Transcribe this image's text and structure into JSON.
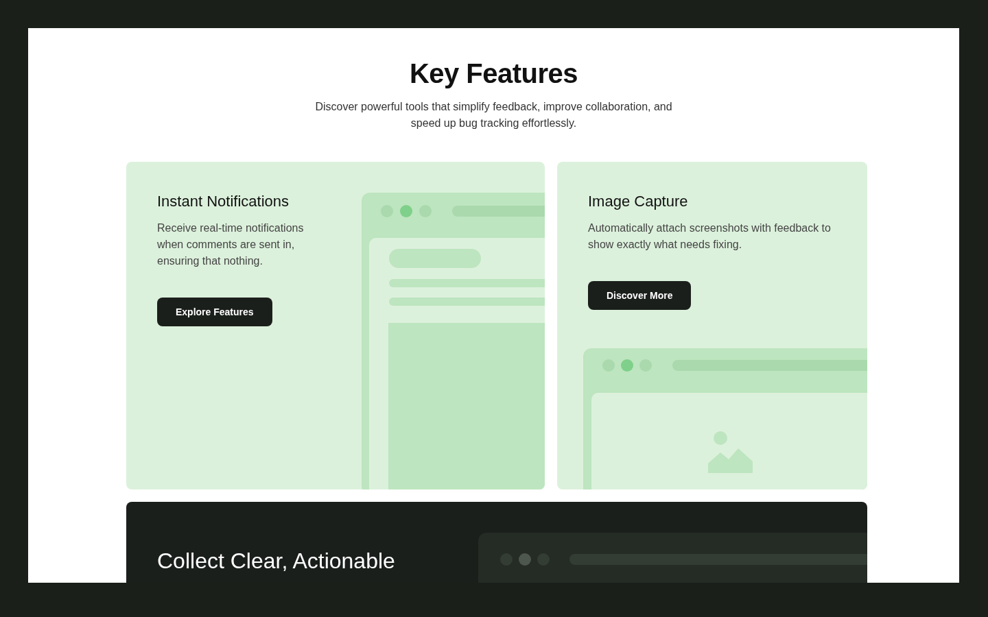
{
  "section": {
    "title": "Key Features",
    "subtitle": "Discover powerful tools that simplify feedback, improve collaboration, and speed up bug tracking effortlessly."
  },
  "cards": [
    {
      "kind": "page",
      "title": "Instant Notifications",
      "description": "Receive real-time notifications when comments are sent in, ensuring that nothing.",
      "button": "Explore Features"
    },
    {
      "kind": "image",
      "title": "Image Capture",
      "description": "Automatically attach screenshots with feedback to show exactly what needs fixing.",
      "button": "Discover More"
    }
  ],
  "banner": {
    "heading": "Collect Clear, Actionable"
  }
}
